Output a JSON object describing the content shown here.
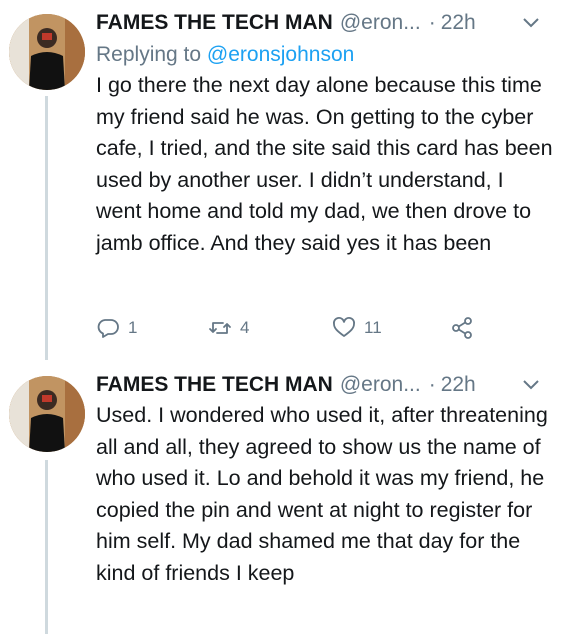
{
  "tweets": [
    {
      "name": "FAMES THE TECH MAN",
      "handle": "@eron...",
      "dot": "·",
      "time": "22h",
      "replying_prefix": "Replying to ",
      "replying_to": "@eronsjohnson",
      "text": "I go there the next day alone because this time my friend said he was. On getting to the cyber cafe, I tried, and the site said this card has been used by another user. I didn’t understand, I went home and told my dad, we then drove to jamb office. And they said yes it has been",
      "replies": "1",
      "retweets": "4",
      "likes": "11"
    },
    {
      "name": "FAMES THE TECH MAN",
      "handle": "@eron...",
      "dot": "·",
      "time": "22h",
      "text": "Used. I wondered who used it, after threatening all and all, they agreed to show us the name of who used it. Lo and behold it was my friend, he copied the pin and went at night to register for him self. My dad shamed me that day for the kind of friends I keep"
    }
  ],
  "icons": {
    "reply": "reply-icon",
    "retweet": "retweet-icon",
    "like": "heart-icon",
    "share": "share-icon",
    "menu": "chevron-down-icon"
  },
  "colors": {
    "accent": "#1da1f2",
    "secondary_text": "#657786",
    "primary_text": "#14171a",
    "thread_line": "#cfd9de"
  }
}
